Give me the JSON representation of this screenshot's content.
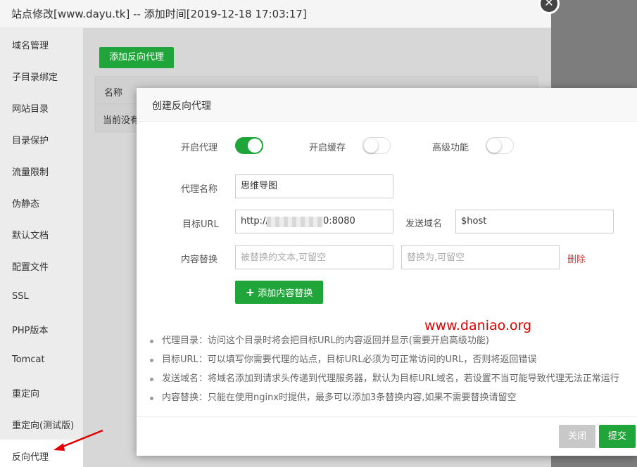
{
  "window": {
    "title": "站点修改[www.dayu.tk] -- 添加时间[2019-12-18 17:03:17]",
    "close_glyph": "✕"
  },
  "sidebar": {
    "items": [
      {
        "label": "域名管理"
      },
      {
        "label": "子目录绑定"
      },
      {
        "label": "网站目录"
      },
      {
        "label": "目录保护"
      },
      {
        "label": "流量限制"
      },
      {
        "label": "伪静态"
      },
      {
        "label": "默认文档"
      },
      {
        "label": "配置文件"
      },
      {
        "label": "SSL"
      },
      {
        "label": "PHP版本"
      },
      {
        "label": "Tomcat"
      },
      {
        "label": "重定向"
      },
      {
        "label": "重定向(测试版)"
      },
      {
        "label": "反向代理",
        "active": true
      }
    ]
  },
  "main": {
    "add_proxy_button": "添加反向代理",
    "table": {
      "columns": [
        "名称"
      ],
      "empty_text": "当前没有"
    }
  },
  "modal": {
    "title": "创建反向代理",
    "toggles": [
      {
        "label": "开启代理",
        "on": true
      },
      {
        "label": "开启缓存",
        "on": false
      },
      {
        "label": "高级功能",
        "on": false
      }
    ],
    "proxy_name": {
      "label": "代理名称",
      "value": "思维导图"
    },
    "target_url": {
      "label": "目标URL",
      "prefix": "http://",
      "suffix": "0:8080"
    },
    "send_domain": {
      "label": "发送域名",
      "value": "$host"
    },
    "content_replace": {
      "label": "内容替换",
      "find_placeholder": "被替换的文本,可留空",
      "replace_placeholder": "替换为,可留空",
      "delete_label": "删除"
    },
    "add_replace_button": "添加内容替换",
    "watermark": "www.daniao.org",
    "tips": [
      "代理目录：访问这个目录时将会把目标URL的内容返回并显示(需要开启高级功能)",
      "目标URL：可以填写你需要代理的站点，目标URL必须为可正常访问的URL，否则将返回错误",
      "发送域名：将域名添加到请求头传递到代理服务器，默认为目标URL域名，若设置不当可能导致代理无法正常运行",
      "内容替换：只能在使用nginx时提供，最多可以添加3条替换内容,如果不需要替换请留空"
    ],
    "buttons": {
      "close": "关闭",
      "submit": "提交"
    }
  },
  "colors": {
    "accent": "#20a53a",
    "danger": "#e4393c",
    "watermark": "#e30000"
  }
}
